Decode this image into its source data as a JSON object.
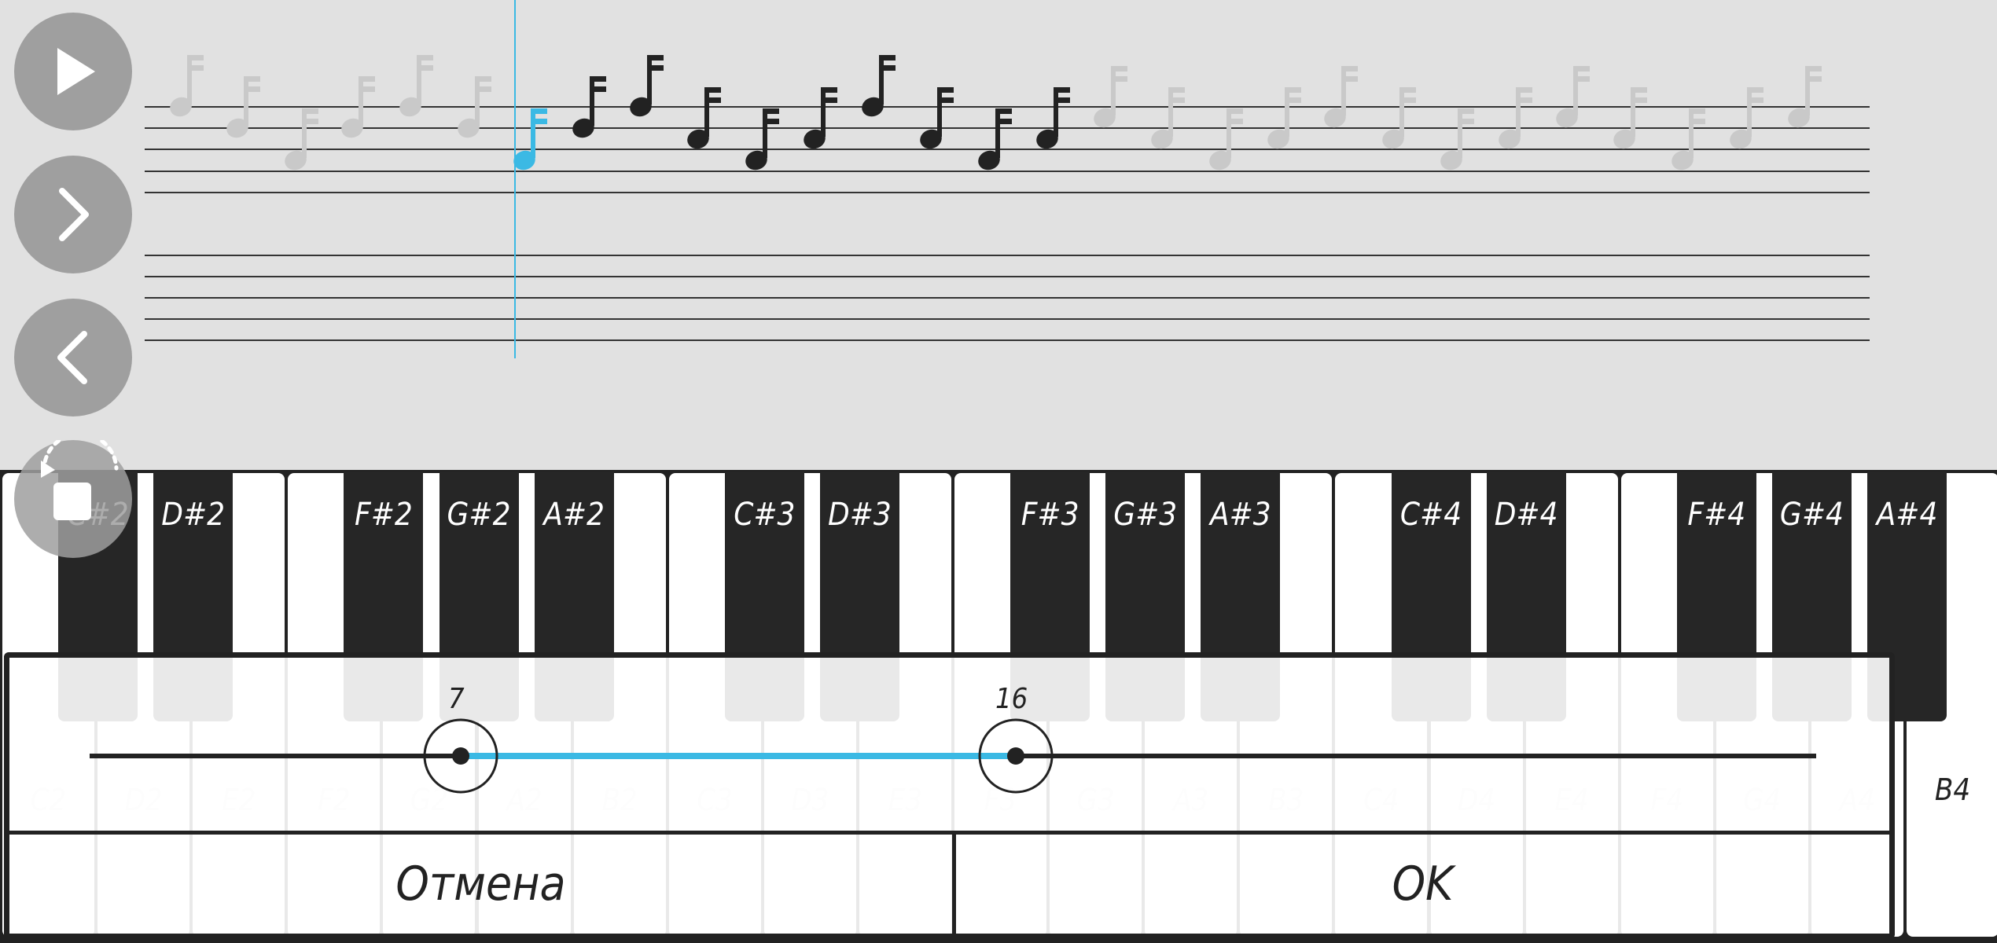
{
  "controls": {
    "play": "play-icon",
    "next": "chevron-right-icon",
    "previous": "chevron-left-icon",
    "loop": "loop-stop-icon"
  },
  "colors": {
    "accent": "#3bb9e4",
    "note_active": "#222222",
    "note_faded": "#c9c9c9",
    "control_button": "#9f9f9f"
  },
  "piano": {
    "white_keys": [
      "C2",
      "D2",
      "E2",
      "F2",
      "G2",
      "A2",
      "B2",
      "C3",
      "D3",
      "E3",
      "F3",
      "G3",
      "A3",
      "B3",
      "C4",
      "D4",
      "E4",
      "F4",
      "G4",
      "A4",
      "B4"
    ],
    "black_keys": [
      "C#2",
      "D#2",
      "F#2",
      "G#2",
      "A#2",
      "C#3",
      "D#3",
      "F#3",
      "G#3",
      "A#3",
      "C#4",
      "D#4",
      "F#4",
      "G#4",
      "A#4"
    ]
  },
  "range_dialog": {
    "min_value": "7",
    "max_value": "16",
    "cancel_label": "Отмена",
    "ok_label": "OK"
  }
}
